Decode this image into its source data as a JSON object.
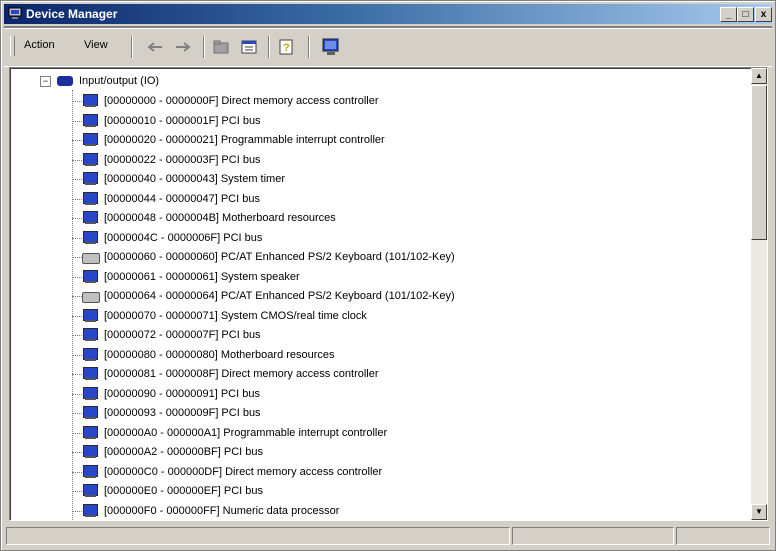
{
  "window": {
    "title": "Device Manager",
    "min_label": "_",
    "max_label": "□",
    "close_label": "x"
  },
  "menu": {
    "action": "Action",
    "view": "View"
  },
  "tree": {
    "root_label": "Input/output (IO)",
    "root_expander": "−",
    "rows": [
      {
        "icon": "monitor-chip-icon",
        "label": "[00000000 - 0000000F]  Direct memory access controller"
      },
      {
        "icon": "monitor-chip-icon",
        "label": "[00000010 - 0000001F]  PCI bus"
      },
      {
        "icon": "monitor-chip-icon",
        "label": "[00000020 - 00000021]  Programmable interrupt controller"
      },
      {
        "icon": "monitor-chip-icon",
        "label": "[00000022 - 0000003F]  PCI bus"
      },
      {
        "icon": "monitor-chip-icon",
        "label": "[00000040 - 00000043]  System timer"
      },
      {
        "icon": "monitor-chip-icon",
        "label": "[00000044 - 00000047]  PCI bus"
      },
      {
        "icon": "monitor-chip-icon",
        "label": "[00000048 - 0000004B]  Motherboard resources"
      },
      {
        "icon": "monitor-chip-icon",
        "label": "[0000004C - 0000006F]  PCI bus"
      },
      {
        "icon": "keyboard-icon",
        "label": "[00000060 - 00000060]  PC/AT Enhanced PS/2 Keyboard (101/102-Key)"
      },
      {
        "icon": "monitor-chip-icon",
        "label": "[00000061 - 00000061]  System speaker"
      },
      {
        "icon": "keyboard-icon",
        "label": "[00000064 - 00000064]  PC/AT Enhanced PS/2 Keyboard (101/102-Key)"
      },
      {
        "icon": "monitor-chip-icon",
        "label": "[00000070 - 00000071]  System CMOS/real time clock"
      },
      {
        "icon": "monitor-chip-icon",
        "label": "[00000072 - 0000007F]  PCI bus"
      },
      {
        "icon": "monitor-chip-icon",
        "label": "[00000080 - 00000080]  Motherboard resources"
      },
      {
        "icon": "monitor-chip-icon",
        "label": "[00000081 - 0000008F]  Direct memory access controller"
      },
      {
        "icon": "monitor-chip-icon",
        "label": "[00000090 - 00000091]  PCI bus"
      },
      {
        "icon": "monitor-chip-icon",
        "label": "[00000093 - 0000009F]  PCI bus"
      },
      {
        "icon": "monitor-chip-icon",
        "label": "[000000A0 - 000000A1]  Programmable interrupt controller"
      },
      {
        "icon": "monitor-chip-icon",
        "label": "[000000A2 - 000000BF]  PCI bus"
      },
      {
        "icon": "monitor-chip-icon",
        "label": "[000000C0 - 000000DF]  Direct memory access controller"
      },
      {
        "icon": "monitor-chip-icon",
        "label": "[000000E0 - 000000EF]  PCI bus"
      },
      {
        "icon": "monitor-chip-icon",
        "label": "[000000F0 - 000000FF]  Numeric data processor"
      }
    ]
  },
  "scrollbar": {
    "up": "▲",
    "down": "▼"
  }
}
